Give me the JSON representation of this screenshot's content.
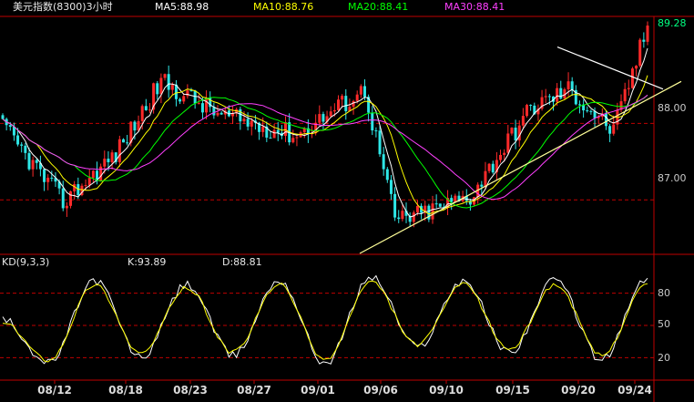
{
  "header": {
    "instrument": "美元指数(8300)3小时",
    "ma_labels": [
      {
        "text": "MA5:88.98",
        "color": "#ffffff"
      },
      {
        "text": "MA10:88.76",
        "color": "#ffff00"
      },
      {
        "text": "MA20:88.41",
        "color": "#00ff00"
      },
      {
        "text": "MA30:88.41",
        "color": "#ff40ff"
      }
    ]
  },
  "price_panel": {
    "last_price": "89.28",
    "y_ticks": [
      "88.00",
      "87.00"
    ]
  },
  "kd_panel": {
    "title": "KD(9,3,3)",
    "k_label": "K:93.89",
    "d_label": "D:88.81",
    "y_ticks": [
      "80",
      "50",
      "20"
    ]
  },
  "x_axis": {
    "ticks": [
      "08/12",
      "08/18",
      "08/23",
      "08/27",
      "09/01",
      "09/06",
      "09/10",
      "09/15",
      "09/20",
      "09/24"
    ]
  },
  "colors": {
    "background": "#000000",
    "frame": "#c00000",
    "up_candle": "#ff2a2a",
    "down_candle": "#2ee6e6",
    "ma5": "#ffffff",
    "ma10": "#ffff00",
    "ma20": "#00ff00",
    "ma30": "#ff40ff",
    "k_line": "#ffffff",
    "d_line": "#ffff00",
    "trendline": "#ffff99"
  },
  "chart_data": [
    {
      "type": "candlestick",
      "title": "美元指数(8300)3小时",
      "ylim": [
        86.3,
        89.4
      ],
      "x": [
        "08/12",
        "08/18",
        "08/23",
        "08/27",
        "09/01",
        "09/06",
        "09/10",
        "09/15",
        "09/20",
        "09/24"
      ],
      "close_path": [
        [
          "08/09",
          87.95
        ],
        [
          "08/12",
          86.98
        ],
        [
          "08/15",
          87.6
        ],
        [
          "08/18",
          88.55
        ],
        [
          "08/23",
          88.1
        ],
        [
          "08/27",
          87.85
        ],
        [
          "08/30",
          88.45
        ],
        [
          "09/02",
          86.75
        ],
        [
          "09/06",
          86.8
        ],
        [
          "09/10",
          87.05
        ],
        [
          "09/15",
          88.2
        ],
        [
          "09/17",
          88.45
        ],
        [
          "09/20",
          87.9
        ],
        [
          "09/24",
          89.28
        ]
      ],
      "series": [
        {
          "name": "MA5",
          "last": 88.98
        },
        {
          "name": "MA10",
          "last": 88.76
        },
        {
          "name": "MA20",
          "last": 88.41
        },
        {
          "name": "MA30",
          "last": 88.41
        }
      ],
      "gridlines": [
        88.0,
        87.0
      ]
    },
    {
      "type": "line",
      "title": "KD(9,3,3)",
      "ylim": [
        0,
        100
      ],
      "gridlines": [
        80,
        50,
        20
      ],
      "x": [
        "08/12",
        "08/18",
        "08/23",
        "08/27",
        "09/01",
        "09/06",
        "09/10",
        "09/15",
        "09/20",
        "09/24"
      ],
      "series": [
        {
          "name": "K",
          "last": 93.89,
          "path": [
            55,
            15,
            92,
            20,
            88,
            22,
            92,
            15,
            95,
            30,
            92,
            25,
            92,
            18,
            94
          ]
        },
        {
          "name": "D",
          "last": 88.81,
          "path": [
            52,
            18,
            88,
            24,
            85,
            25,
            88,
            18,
            90,
            32,
            88,
            28,
            88,
            22,
            89
          ]
        }
      ]
    }
  ]
}
